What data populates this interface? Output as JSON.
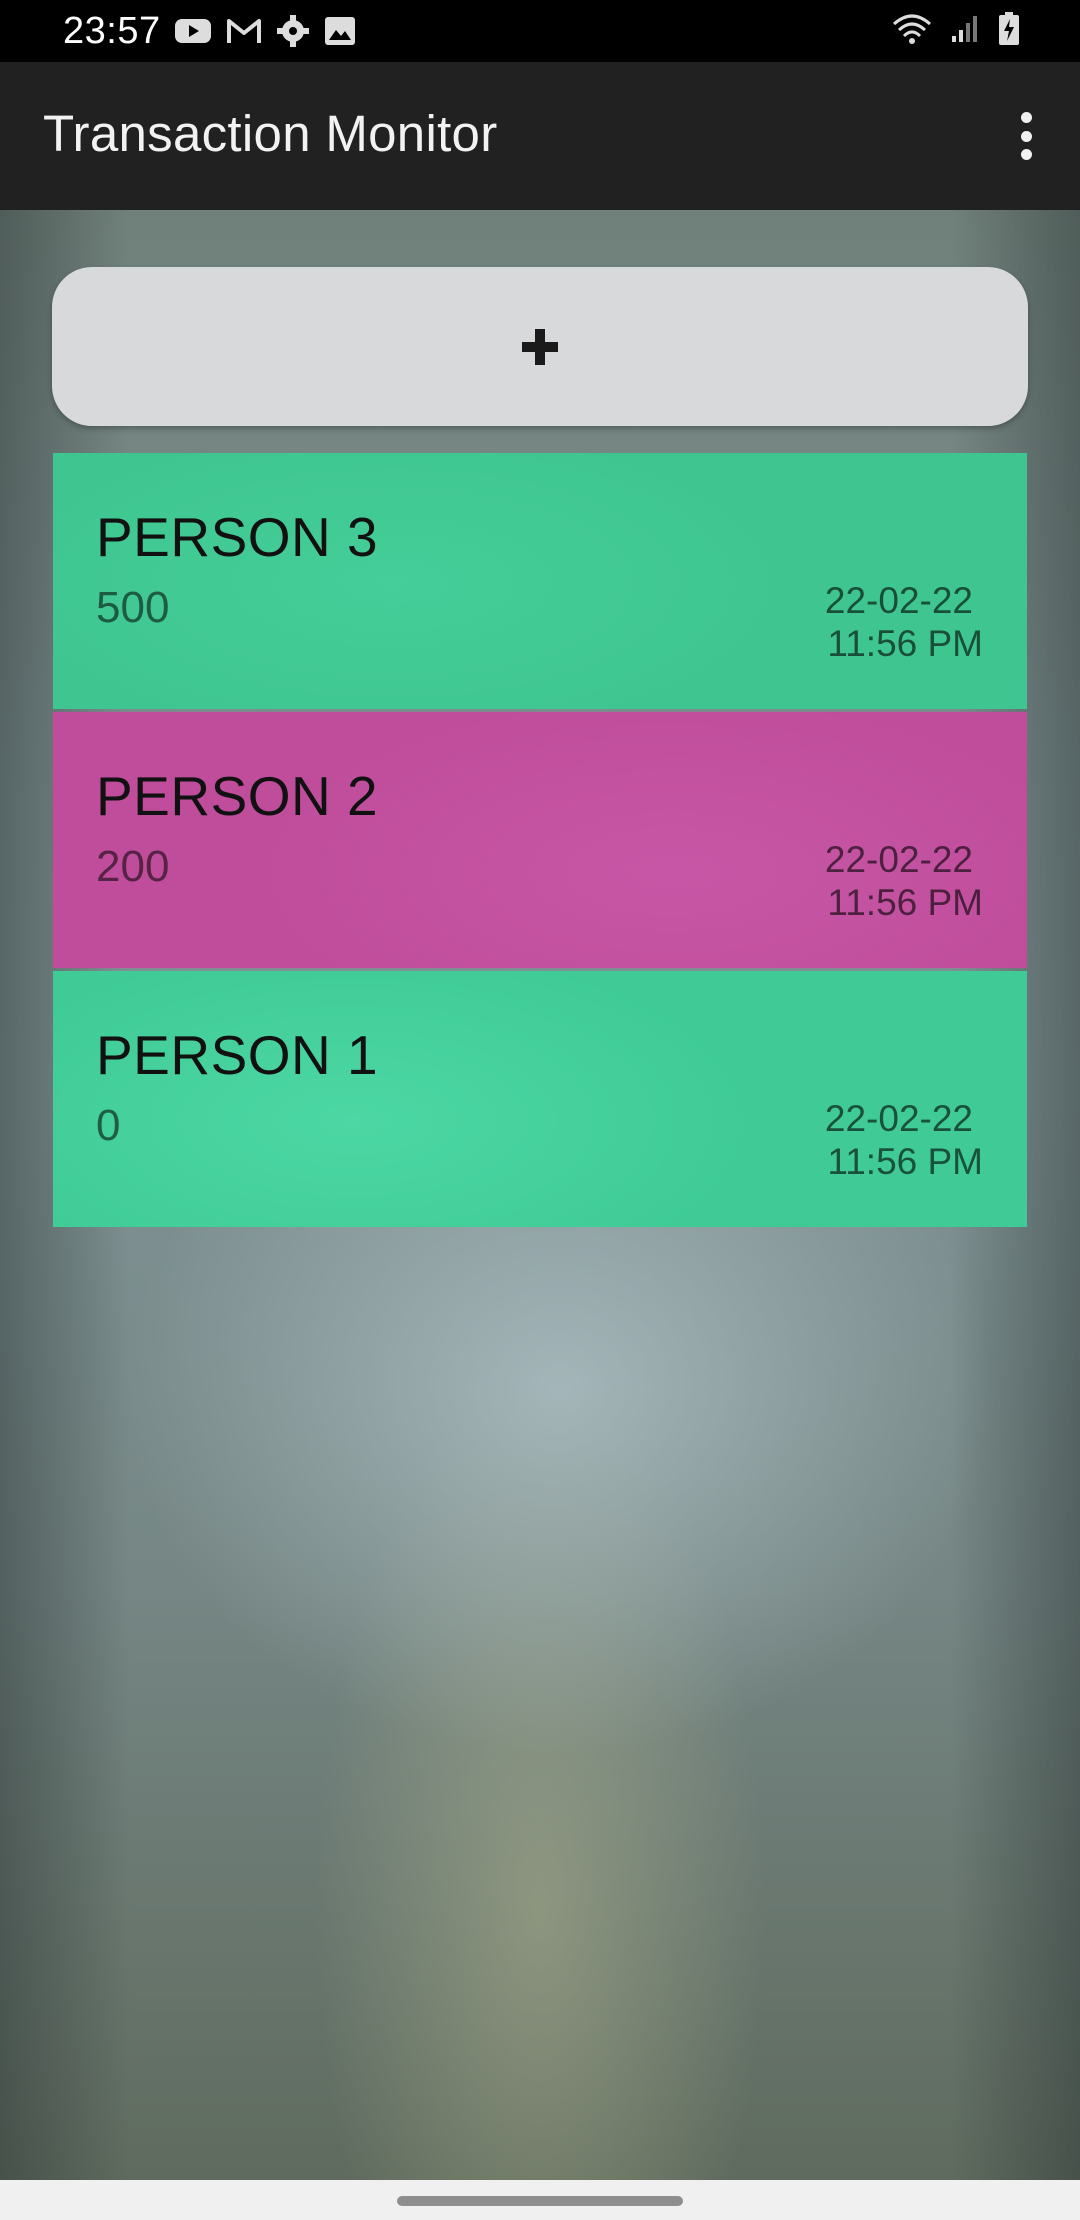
{
  "status_bar": {
    "time": "23:57",
    "left_icons": [
      "youtube-icon",
      "gmail-icon",
      "settings-gear-icon",
      "image-icon"
    ],
    "right_icons": [
      "wifi-icon",
      "signal-icon",
      "battery-charging-icon"
    ]
  },
  "app_bar": {
    "title": "Transaction Monitor",
    "menu_icon": "more-vert-icon"
  },
  "add_button": {
    "icon": "plus-icon"
  },
  "transactions": [
    {
      "name": "PERSON 3",
      "amount": "500",
      "date": "22-02-22",
      "time": "11:56 PM",
      "color": "#3fc690"
    },
    {
      "name": "PERSON 2",
      "amount": "200",
      "date": "22-02-22",
      "time": "11:56 PM",
      "color": "#bf4d9b"
    },
    {
      "name": "PERSON 1",
      "amount": "0",
      "date": "22-02-22",
      "time": "11:56 PM",
      "color": "#40cb96"
    }
  ],
  "colors": {
    "status_bar": "#000000",
    "app_bar": "#212121",
    "add_button": "#d7d9da",
    "positive": "#3fc690",
    "negative": "#bf4d9b"
  }
}
